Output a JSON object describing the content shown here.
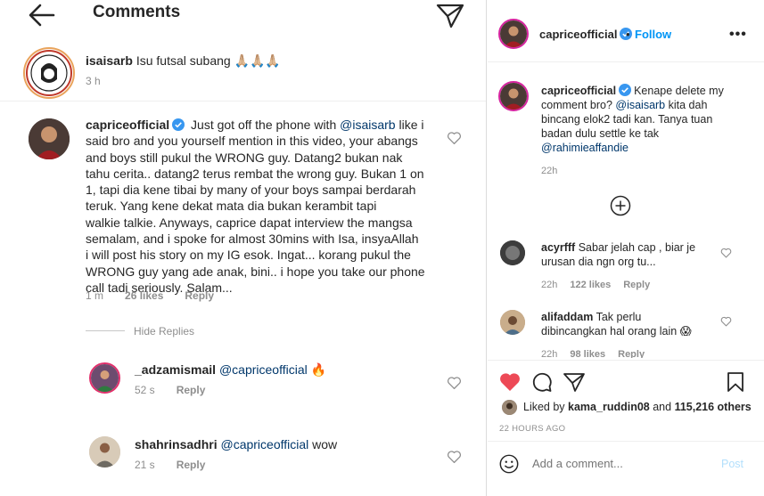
{
  "left": {
    "title": "Comments",
    "icons": {
      "back": "arrow-left-icon",
      "send": "paper-plane-icon"
    },
    "caption": {
      "username": "isaisarb",
      "text": "Isu futsal subang 🙏🏼🙏🏼🙏🏼",
      "time": "3 h"
    },
    "main_comment": {
      "username": "capriceofficial",
      "lines": [
        "Just got off the phone with @isaisarb like i",
        "said bro and you yourself mention in this video, your abangs",
        "and boys still pukul the WRONG guy. Datang2 bukan nak",
        "tahu cerita.. datang2 terus rembat the wrong guy. Bukan 1 on",
        "1, tapi dia kene tibai by many of your boys sampai berdarah",
        "teruk. Yang kene dekat mata dia bukan kerambit tapi",
        "walkie talkie. Anyways, caprice dapat interview the mangsa",
        "semalam, and i spoke for almost 30mins with Isa, insyaAllah",
        "i will post his story on my IG esok. Ingat... korang pukul the",
        "WRONG guy yang ade anak, bini.. i hope you take our phone",
        "call tadi seriously. Salam..."
      ],
      "first_line_text": "Just got off the phone with ",
      "first_line_mention": "@isaisarb",
      "first_line_rest": " like i",
      "time": "1 m",
      "likes": "26 likes",
      "reply": "Reply"
    },
    "hide_replies": "Hide Replies",
    "replies": [
      {
        "username": "_adzamismail",
        "mention": "@capriceofficial",
        "text": "🔥",
        "time": "52 s",
        "reply": "Reply"
      },
      {
        "username": "shahrinsadhri",
        "mention": "@capriceofficial",
        "text": "wow",
        "time": "21 s",
        "reply": "Reply"
      }
    ]
  },
  "right": {
    "header": {
      "username": "capriceofficial",
      "follow": "Follow",
      "dot": "•",
      "more": "•••"
    },
    "comment": {
      "username": "capriceofficial",
      "text_a": "Kenape delete my",
      "line2_a": "comment bro? ",
      "line2_mention": "@isaisarb",
      "line2_b": " kita dah",
      "line3": "bincang elok2 tadi kan. Tanya tuan",
      "line4": "badan dulu settle ke tak",
      "line5_mention": "@rahimieaffandie",
      "time": "22h"
    },
    "comments": [
      {
        "username": "acyrfff",
        "line1": "Sabar jelah cap , biar je",
        "line2": "urusan dia ngn org tu...",
        "time": "22h",
        "likes": "122 likes",
        "reply": "Reply"
      },
      {
        "username": "alifaddam",
        "line1": "Tak perlu",
        "line2": "dibincangkan hal orang lain 😱",
        "time": "22h",
        "likes": "98 likes",
        "reply": "Reply"
      }
    ],
    "liked_by": {
      "prefix": "Liked by ",
      "user": "kama_ruddin08",
      "mid": " and ",
      "count": "115,216 others"
    },
    "time_ago": "22 HOURS AGO",
    "add_comment_placeholder": "Add a comment...",
    "post": "Post"
  },
  "colors": {
    "accent": "#0095f6",
    "like_red": "#ed4956",
    "verified": "#3897f0",
    "muted": "#8e8e8e",
    "mention": "#00376b"
  }
}
